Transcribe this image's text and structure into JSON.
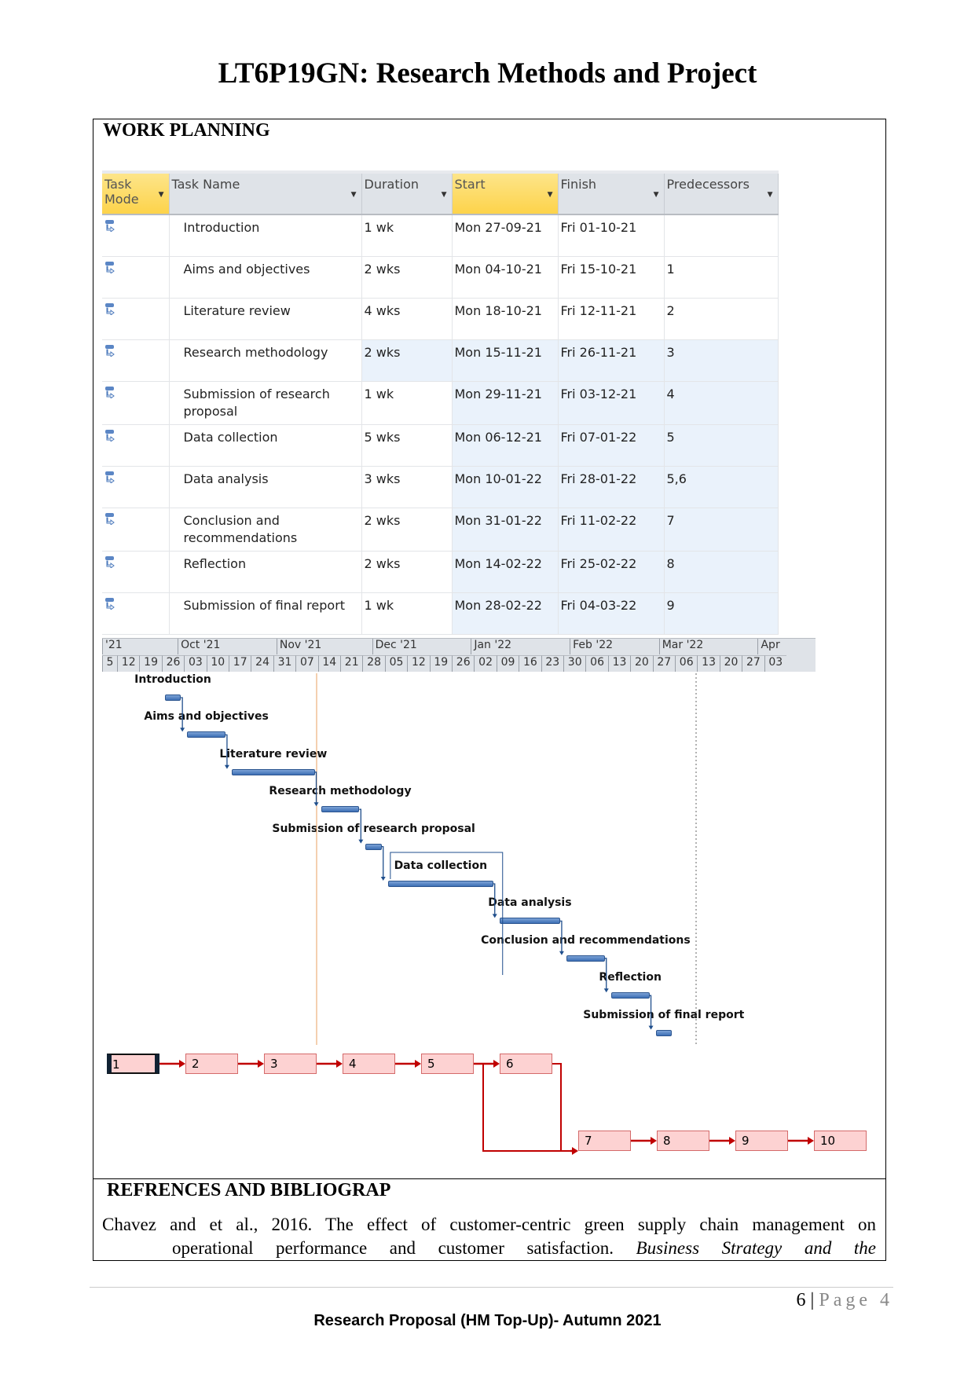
{
  "title": "LT6P19GN: Research Methods and Project",
  "section_heading": "WORK PLANNING",
  "table": {
    "columns": [
      "Task Mode",
      "Task Name",
      "Duration",
      "Start",
      "Finish",
      "Predecessors"
    ],
    "rows": [
      {
        "name": "Introduction",
        "duration": "1 wk",
        "start": "Mon 27-09-21",
        "finish": "Fri 01-10-21",
        "pred": ""
      },
      {
        "name": "Aims and objectives",
        "duration": "2 wks",
        "start": "Mon 04-10-21",
        "finish": "Fri 15-10-21",
        "pred": "1"
      },
      {
        "name": "Literature review",
        "duration": "4 wks",
        "start": "Mon 18-10-21",
        "finish": "Fri 12-11-21",
        "pred": "2"
      },
      {
        "name": "Research methodology",
        "duration": "2 wks",
        "start": "Mon 15-11-21",
        "finish": "Fri 26-11-21",
        "pred": "3"
      },
      {
        "name": "Submission of research proposal",
        "duration": "1 wk",
        "start": "Mon 29-11-21",
        "finish": "Fri 03-12-21",
        "pred": "4"
      },
      {
        "name": "Data collection",
        "duration": "5 wks",
        "start": "Mon 06-12-21",
        "finish": "Fri 07-01-22",
        "pred": "5"
      },
      {
        "name": "Data analysis",
        "duration": "3 wks",
        "start": "Mon 10-01-22",
        "finish": "Fri 28-01-22",
        "pred": "5,6"
      },
      {
        "name": "Conclusion and recommendations",
        "duration": "2 wks",
        "start": "Mon 31-01-22",
        "finish": "Fri 11-02-22",
        "pred": "7"
      },
      {
        "name": "Reflection",
        "duration": "2 wks",
        "start": "Mon 14-02-22",
        "finish": "Fri 25-02-22",
        "pred": "8"
      },
      {
        "name": "Submission of final report",
        "duration": "1 wk",
        "start": "Mon 28-02-22",
        "finish": "Fri 04-03-22",
        "pred": "9"
      }
    ]
  },
  "timeline": {
    "months": [
      "'21",
      "Oct '21",
      "Nov '21",
      "Dec '21",
      "Jan '22",
      "Feb '22",
      "Mar '22",
      "Apr"
    ],
    "weeks": [
      "5",
      "12",
      "19",
      "26",
      "03",
      "10",
      "17",
      "24",
      "31",
      "07",
      "14",
      "21",
      "28",
      "05",
      "12",
      "19",
      "26",
      "02",
      "09",
      "16",
      "23",
      "30",
      "06",
      "13",
      "20",
      "27",
      "06",
      "13",
      "20",
      "27",
      "03"
    ]
  },
  "gantt_labels": [
    "Introduction",
    "Aims and objectives",
    "Literature review",
    "Research methodology",
    "Submission of research proposal",
    "Data collection",
    "Data analysis",
    "Conclusion and recommendations",
    "Reflection",
    "Submission of final report"
  ],
  "network": [
    "1",
    "2",
    "3",
    "4",
    "5",
    "6",
    "7",
    "8",
    "9",
    "10"
  ],
  "colors": {
    "bar": "#3d6fb5",
    "network_box": "#fdd2d2",
    "network_line": "#c00000",
    "header_highlight": "#fdd34a"
  },
  "references": {
    "heading": "REFRENCES AND BIBLIOGRAP",
    "line1": "Chavez and et al., 2016. The effect of customer-centric green supply chain management on",
    "line2_plain": "operational performance and customer satisfaction.",
    "line2_italic": "Business Strategy and the"
  },
  "footer": {
    "page_number": "6",
    "page_label": "Page 4",
    "text": "Research Proposal (HM Top-Up)- Autumn 2021"
  }
}
